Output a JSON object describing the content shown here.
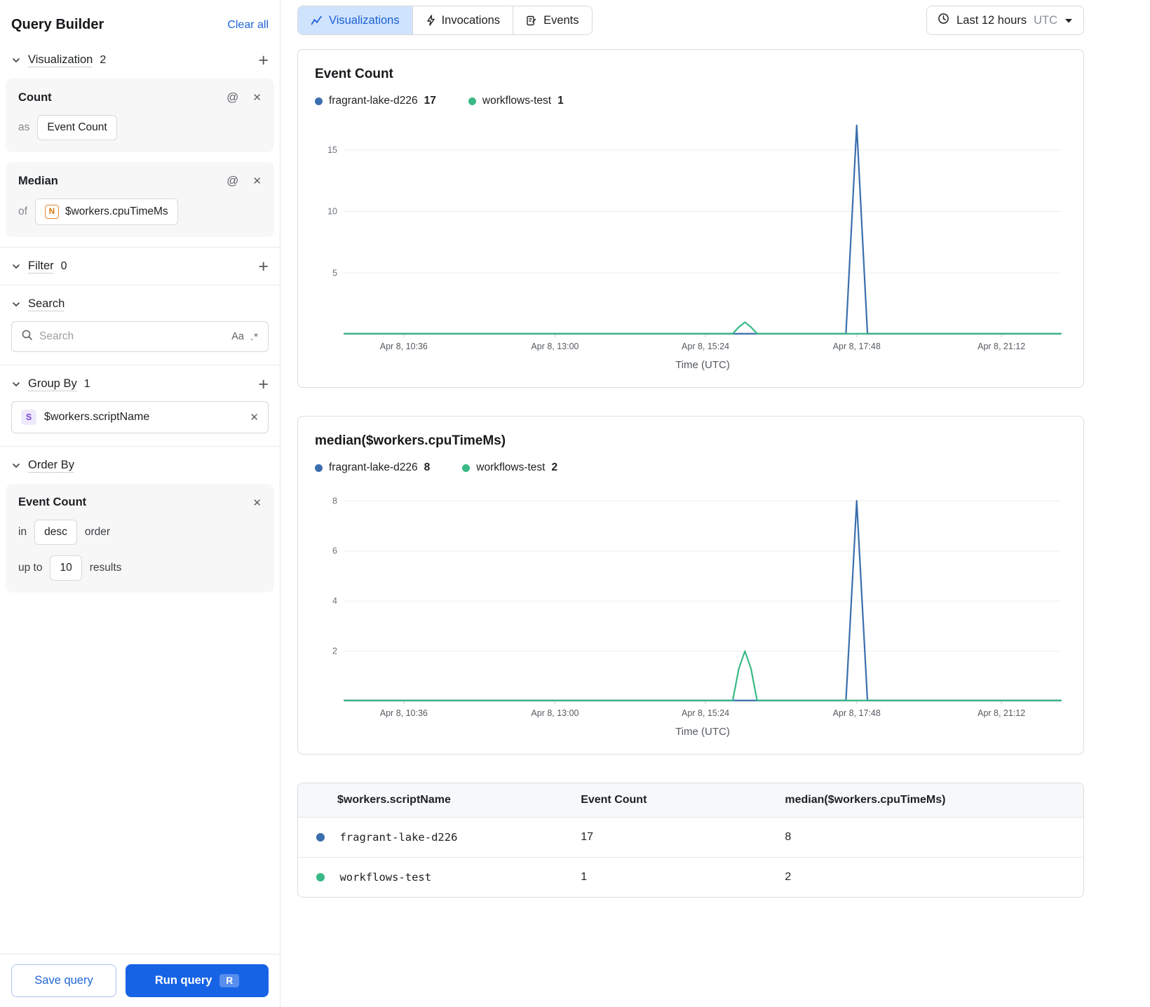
{
  "icons": {
    "plus": "+",
    "at": "@",
    "close": "✕",
    "match_case": "Aa",
    "regex": ".*"
  },
  "colors": {
    "accent": "#1763e6",
    "tab_bg": "#d0e3fc",
    "series_blue": "#3b6eae",
    "series_green": "#38b985"
  },
  "sidebar": {
    "title": "Query Builder",
    "clear_all_label": "Clear all",
    "sections": {
      "visualization": {
        "label": "Visualization",
        "count": "2"
      },
      "filter": {
        "label": "Filter",
        "count": "0"
      },
      "search": {
        "label": "Search",
        "placeholder": "Search"
      },
      "group_by": {
        "label": "Group By",
        "count": "1",
        "item": {
          "type_icon": "S",
          "value": "$workers.scriptName"
        }
      },
      "order_by": {
        "label": "Order By",
        "card": {
          "title": "Event Count",
          "in_label": "in",
          "order_value": "desc",
          "order_suffix": "order",
          "upto_label": "up to",
          "limit_value": "10",
          "results_suffix": "results"
        }
      }
    },
    "cards": [
      {
        "title": "Count",
        "prefix": "as",
        "value": "Event Count"
      },
      {
        "title": "Median",
        "prefix": "of",
        "value": "$workers.cpuTimeMs",
        "type_icon": "N"
      }
    ],
    "footer": {
      "save_label": "Save query",
      "run_label": "Run query",
      "run_kbd": "R"
    }
  },
  "topbar": {
    "tabs": [
      {
        "label": "Visualizations"
      },
      {
        "label": "Invocations"
      },
      {
        "label": "Events"
      }
    ],
    "time_range": {
      "label": "Last 12 hours",
      "tz": "UTC"
    }
  },
  "chart_data": [
    {
      "type": "line",
      "title": "Event Count",
      "xlabel": "Time (UTC)",
      "x_ticks": [
        "Apr 8, 10:36",
        "Apr 8, 13:00",
        "Apr 8, 15:24",
        "Apr 8, 17:48",
        "Apr 8, 21:12"
      ],
      "x_tick_fractions": [
        0.083,
        0.294,
        0.504,
        0.715,
        0.917
      ],
      "ylim": [
        0,
        17.1
      ],
      "y_ticks": [
        5,
        10,
        15
      ],
      "grid": true,
      "legend_position": "top",
      "legend": [
        {
          "name": "fragrant-lake-d226",
          "value": 17,
          "color": "#3b6eae"
        },
        {
          "name": "workflows-test",
          "value": 1,
          "color": "#38b985"
        }
      ],
      "series": [
        {
          "name": "fragrant-lake-d226",
          "color": "#3b6eae",
          "points": [
            [
              0,
              0
            ],
            [
              0.7,
              0
            ],
            [
              0.7075,
              8.5
            ],
            [
              0.715,
              17
            ],
            [
              0.7225,
              8.5
            ],
            [
              0.73,
              0
            ],
            [
              1,
              0
            ]
          ]
        },
        {
          "name": "workflows-test",
          "color": "#38b985",
          "points": [
            [
              0,
              0
            ],
            [
              0.542,
              0
            ],
            [
              0.5505,
              0.6
            ],
            [
              0.559,
              1
            ],
            [
              0.5675,
              0.6
            ],
            [
              0.576,
              0
            ],
            [
              1,
              0
            ]
          ]
        }
      ]
    },
    {
      "type": "line",
      "title": "median($workers.cpuTimeMs)",
      "xlabel": "Time (UTC)",
      "x_ticks": [
        "Apr 8, 10:36",
        "Apr 8, 13:00",
        "Apr 8, 15:24",
        "Apr 8, 17:48",
        "Apr 8, 21:12"
      ],
      "x_tick_fractions": [
        0.083,
        0.294,
        0.504,
        0.715,
        0.917
      ],
      "ylim": [
        0,
        8.4
      ],
      "y_ticks": [
        2,
        4,
        6,
        8
      ],
      "grid": true,
      "legend_position": "top",
      "legend": [
        {
          "name": "fragrant-lake-d226",
          "value": 8,
          "color": "#3b6eae"
        },
        {
          "name": "workflows-test",
          "value": 2,
          "color": "#38b985"
        }
      ],
      "series": [
        {
          "name": "fragrant-lake-d226",
          "color": "#3b6eae",
          "points": [
            [
              0,
              0
            ],
            [
              0.7,
              0
            ],
            [
              0.7075,
              4
            ],
            [
              0.715,
              8
            ],
            [
              0.7225,
              4
            ],
            [
              0.73,
              0
            ],
            [
              1,
              0
            ]
          ]
        },
        {
          "name": "workflows-test",
          "color": "#38b985",
          "points": [
            [
              0,
              0
            ],
            [
              0.542,
              0
            ],
            [
              0.5505,
              1.3
            ],
            [
              0.559,
              2
            ],
            [
              0.5675,
              1.3
            ],
            [
              0.576,
              0
            ],
            [
              1,
              0
            ]
          ]
        }
      ]
    }
  ],
  "table": {
    "headers": [
      "$workers.scriptName",
      "Event Count",
      "median($workers.cpuTimeMs)"
    ],
    "rows": [
      {
        "name": "fragrant-lake-d226",
        "event_count": "17",
        "median": "8",
        "color": "#3b6eae"
      },
      {
        "name": "workflows-test",
        "event_count": "1",
        "median": "2",
        "color": "#38b985"
      }
    ]
  }
}
